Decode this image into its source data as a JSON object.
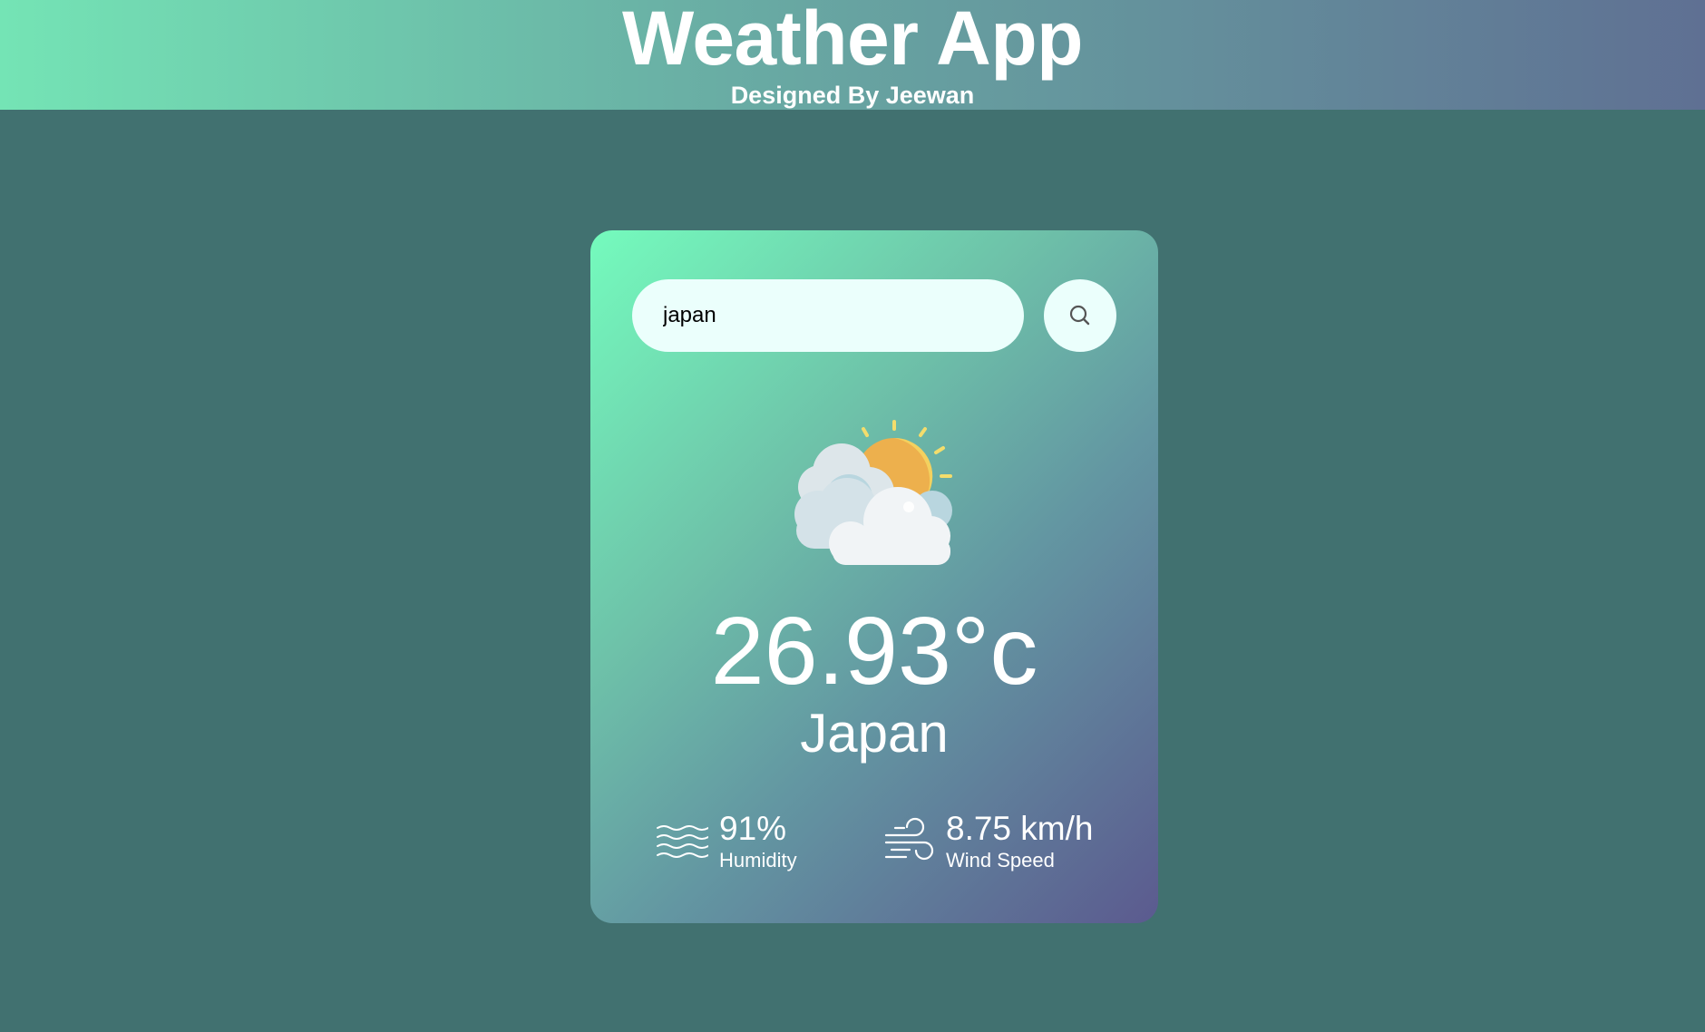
{
  "header": {
    "title": "Weather App",
    "subtitle": "Designed By Jeewan"
  },
  "search": {
    "value": "japan",
    "placeholder": "",
    "button_icon": "search-icon"
  },
  "weather": {
    "icon": "partly-cloudy-sun-icon",
    "temperature": "26.93°c",
    "city": "Japan"
  },
  "details": {
    "humidity": {
      "icon": "humidity-waves-icon",
      "value": "91%",
      "label": "Humidity"
    },
    "wind": {
      "icon": "wind-icon",
      "value": "8.75 km/h",
      "label": "Wind Speed"
    }
  },
  "colors": {
    "page_background": "#417170",
    "card_gradient_start": "#74fbbd",
    "card_gradient_end": "#5b5a8f",
    "input_background": "#ebfffc"
  }
}
